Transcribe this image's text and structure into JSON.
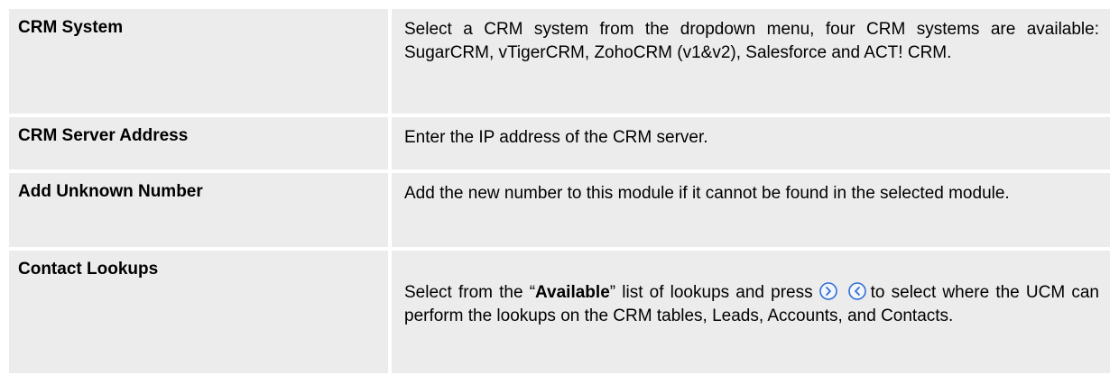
{
  "rows": [
    {
      "label": "CRM System",
      "description": "Select a CRM system from the dropdown menu, four CRM systems are available: SugarCRM, vTigerCRM, ZohoCRM (v1&v2), Salesforce and ACT! CRM."
    },
    {
      "label": "CRM Server Address",
      "description": "Enter the IP address of the CRM server."
    },
    {
      "label": "Add Unknown Number",
      "description": "Add the new number to this module if it cannot be found in the selected module."
    },
    {
      "label": "Contact Lookups",
      "desc_before": "Select from the “",
      "desc_bold": "Available",
      "desc_middle": "” list of lookups and press",
      "desc_after": "to select where the UCM can perform the lookups on the CRM tables, Leads, Accounts, and Contacts.",
      "icons": [
        "move-right-circle-icon",
        "move-left-circle-icon"
      ]
    }
  ],
  "colors": {
    "cell_background": "#ececec",
    "icon_blue": "#2f6fd6"
  }
}
